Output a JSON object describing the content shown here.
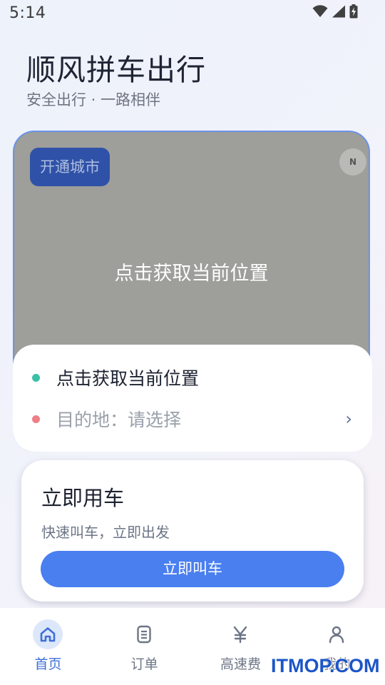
{
  "status_bar": {
    "time": "5:14",
    "icons": [
      "wifi-icon",
      "signal-icon",
      "battery-charging-icon"
    ]
  },
  "header": {
    "title": "顺风拼车出行",
    "subtitle": "安全出行 · 一路相伴"
  },
  "map": {
    "city_button_label": "开通城市",
    "compass_label": "N",
    "center_prompt": "点击获取当前位置"
  },
  "locations": {
    "origin_text": "点击获取当前位置",
    "destination_text": "目的地：请选择",
    "origin_dot_color": "#3dbfa6",
    "destination_dot_color": "#ee7f86",
    "chevron": "›"
  },
  "ride_card": {
    "title": "立即用车",
    "subtitle": "快速叫车，立即出发",
    "button_label": "立即叫车",
    "button_color": "#4a7ff0"
  },
  "bottom_nav": {
    "items": [
      {
        "label": "首页",
        "icon": "home-icon",
        "active": true
      },
      {
        "label": "订单",
        "icon": "document-icon",
        "active": false
      },
      {
        "label": "高速费",
        "icon": "yen-icon",
        "active": false
      },
      {
        "label": "我的",
        "icon": "user-icon",
        "active": false
      }
    ],
    "active_color": "#3f6fd8"
  },
  "watermark": "ITMOP.COM"
}
